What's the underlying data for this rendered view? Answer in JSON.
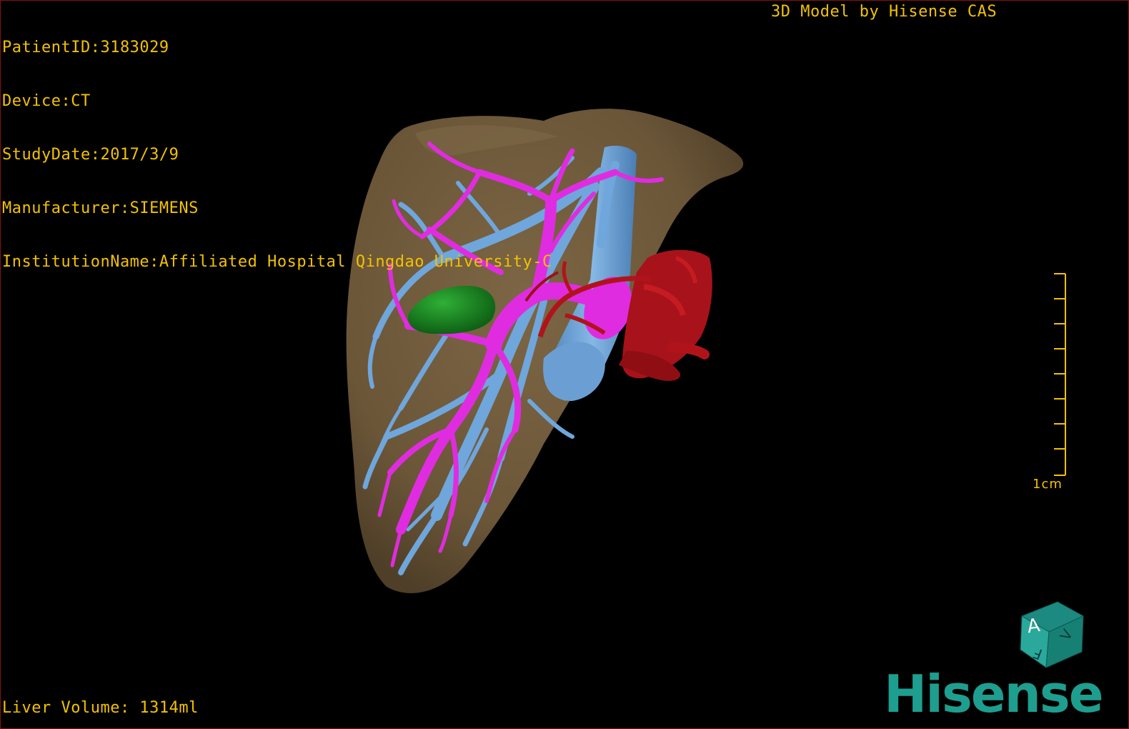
{
  "dicom": {
    "patient_id": "PatientID:3183029",
    "device": "Device:CT",
    "study_date": "StudyDate:2017/3/9",
    "manufacturer": "Manufacturer:SIEMENS",
    "institution": "InstitutionName:Affiliated Hospital Qingdao University-C"
  },
  "credit": "3D Model by Hisense CAS",
  "liver_volume": "Liver Volume: 1314ml",
  "scale_bar": {
    "label": "1cm"
  },
  "orientation_cube": {
    "face_front": "A",
    "face_bottom": "F",
    "face_side": "V"
  },
  "brand": "Hisense",
  "colors": {
    "overlay_text": "#f2c200",
    "liver": "#6f5a3c",
    "portal_vein": "#e02ce0",
    "hepatic_vein": "#6fa6dc",
    "artery": "#b0141a",
    "lesion": "#17801c",
    "brand": "#1e9e8e",
    "frame": "#8a1010"
  }
}
